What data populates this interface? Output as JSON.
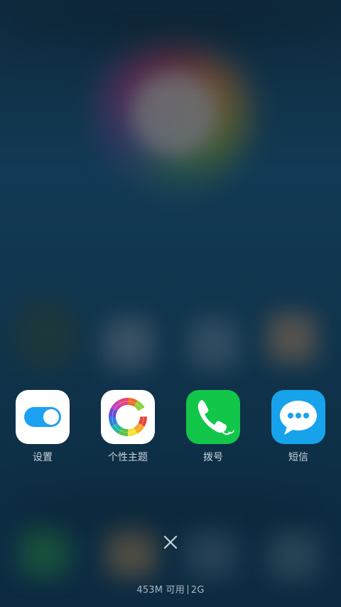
{
  "apps": [
    {
      "label": "设置",
      "icon": "settings-toggle-icon",
      "bg": "#ffffff",
      "accent": "#1da1f2"
    },
    {
      "label": "个性主题",
      "icon": "theme-ring-icon",
      "bg": "#ffffff"
    },
    {
      "label": "拨号",
      "icon": "phone-icon",
      "bg": "#12c64a"
    },
    {
      "label": "短信",
      "icon": "message-bubble-icon",
      "bg": "#17a2ec"
    }
  ],
  "close": {
    "icon": "close-icon"
  },
  "status": {
    "memory": "453M 可用",
    "storage": "2G"
  }
}
